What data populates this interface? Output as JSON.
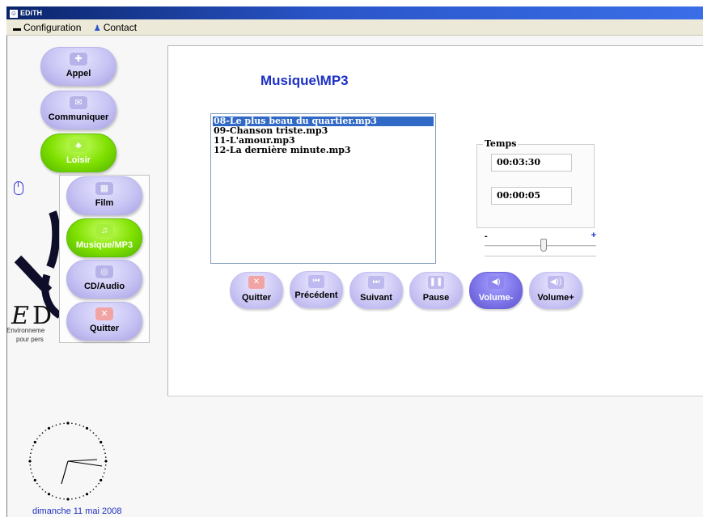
{
  "window": {
    "title": "EDiTH"
  },
  "menu": {
    "items": [
      {
        "label": "Configuration",
        "icon": "config-icon"
      },
      {
        "label": "Contact",
        "icon": "person-icon"
      }
    ]
  },
  "nav": {
    "appel": "Appel",
    "communiquer": "Communiquer",
    "loisir": "Loisir"
  },
  "submenu": {
    "film": "Film",
    "musique": "Musique/MP3",
    "cdaudio": "CD/Audio",
    "quitter": "Quitter"
  },
  "logo": {
    "line1": "Environneme",
    "line2": "pour  pers"
  },
  "panel": {
    "title": "Musique\\MP3",
    "playlist": [
      "08-Le plus beau du quartier.mp3",
      "09-Chanson triste.mp3",
      "11-L'amour.mp3",
      "12-La dernière minute.mp3"
    ],
    "selected_index": 0,
    "temps_label": "Temps",
    "time_total": "00:03:30",
    "time_elapsed": "00:00:05",
    "volume": {
      "minus": "-",
      "plus": "+",
      "level": 0.5
    }
  },
  "controls": {
    "quitter": "Quitter",
    "precedent": "Précédent",
    "suivant": "Suivant",
    "pause": "Pause",
    "volume_minus": "Volume-",
    "volume_plus": "Volume+"
  },
  "footer": {
    "date": "dimanche 11 mai 2008"
  },
  "colors": {
    "accent_blue": "#1c2fc4",
    "green": "#7fe000",
    "selection": "#3169c6"
  }
}
